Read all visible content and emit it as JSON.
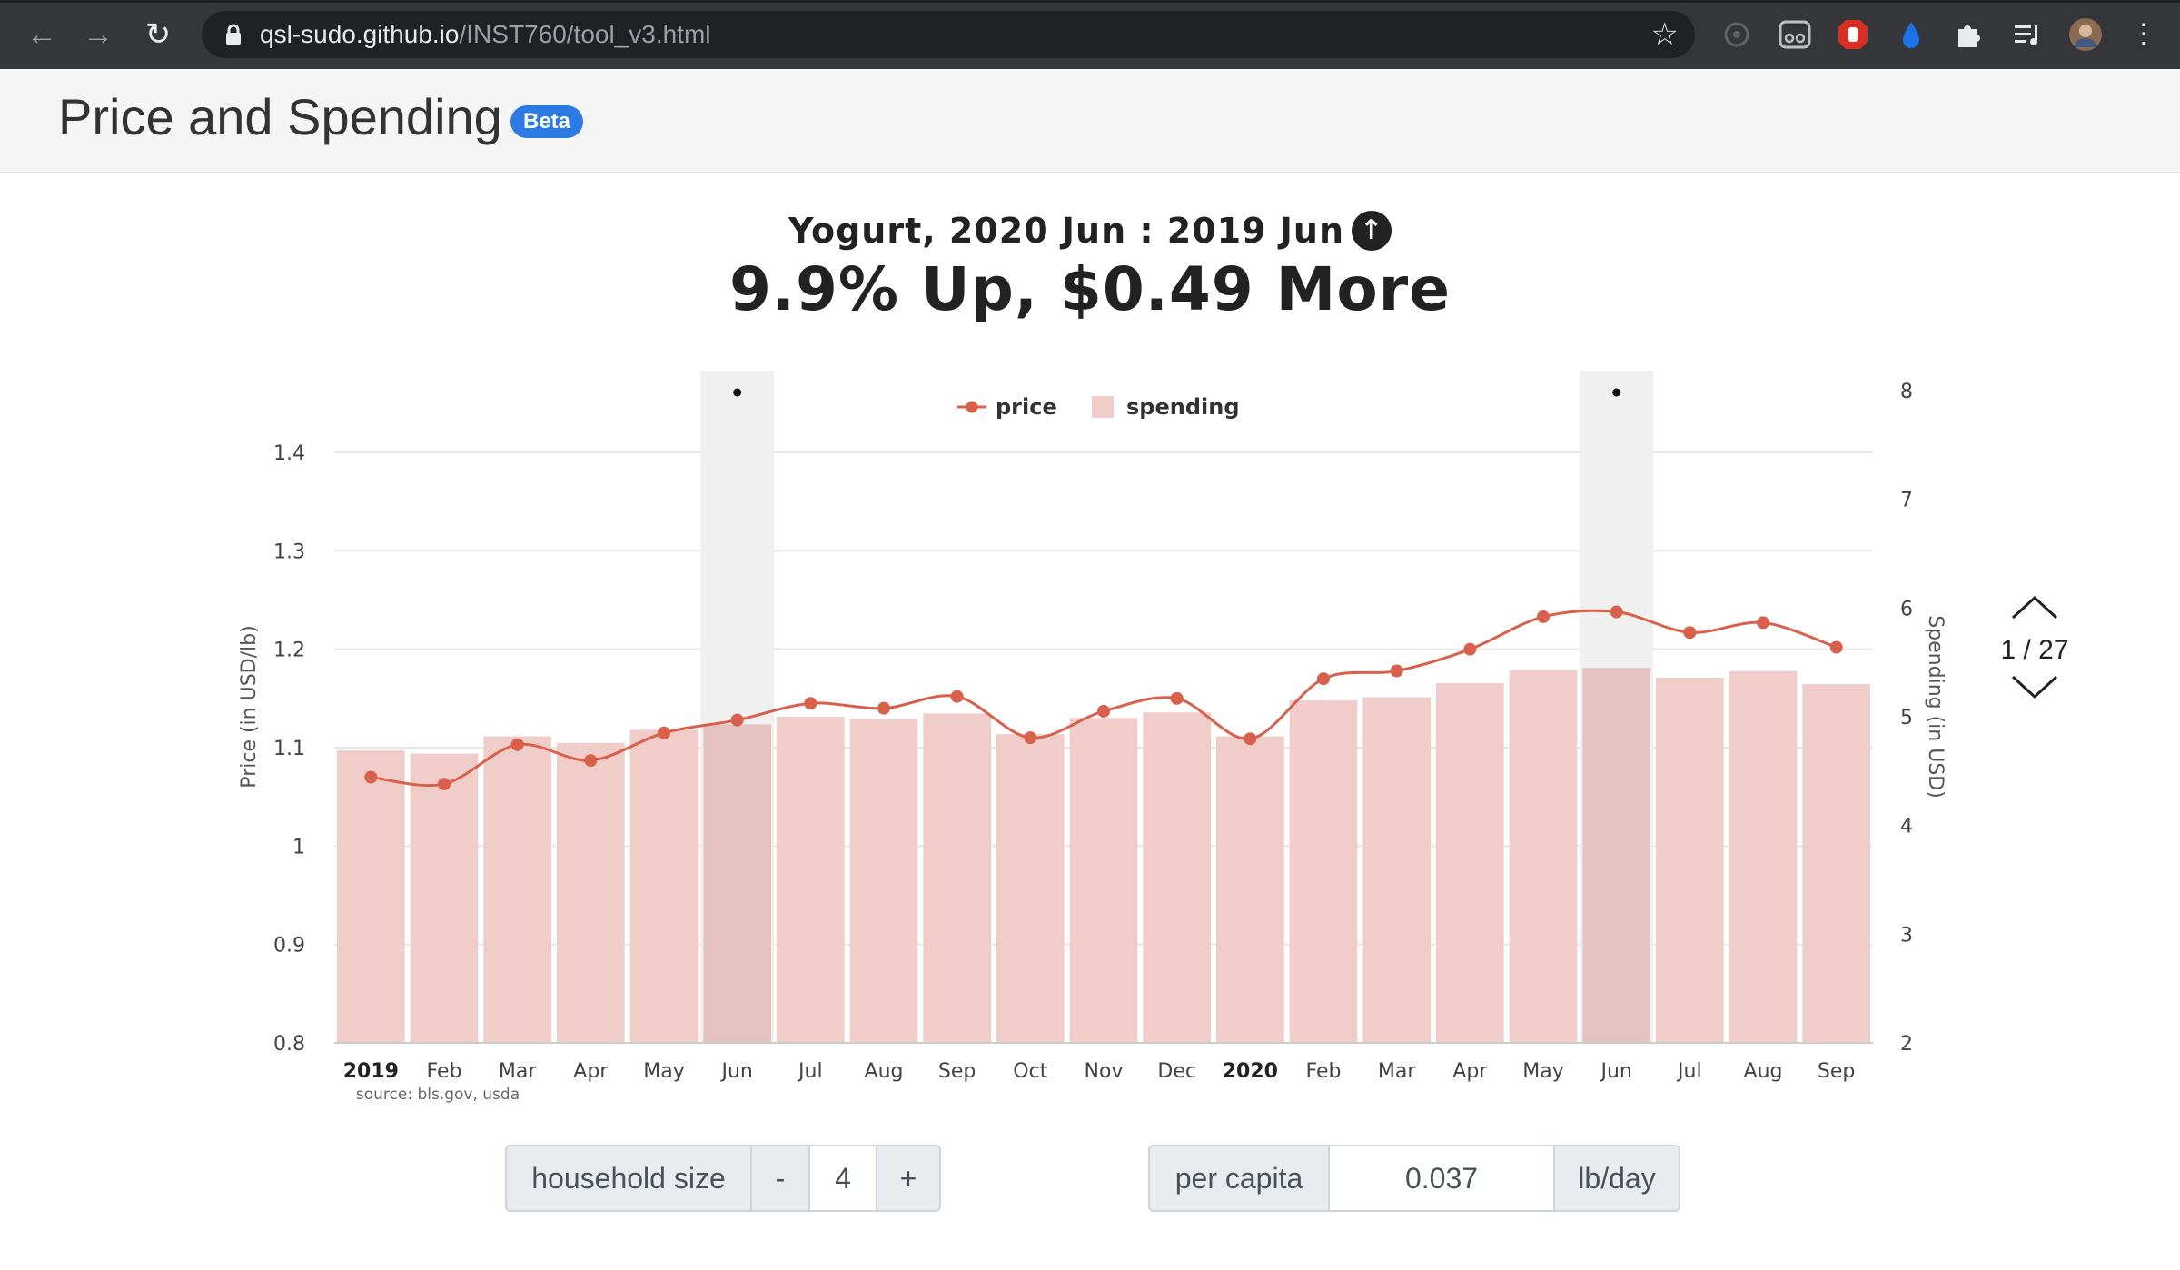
{
  "browser": {
    "url_host": "qsl-sudo.github.io",
    "url_path": "/INST760/tool_v3.html"
  },
  "app": {
    "title": "Price and Spending",
    "badge": "Beta"
  },
  "headline": {
    "subtitle": "Yogurt,  2020 Jun : 2019 Jun",
    "main": "9.9% Up, $0.49 More",
    "arrow_icon": "arrow-up-circle-icon"
  },
  "pager": {
    "count": "1 / 27"
  },
  "controls": {
    "household_label": "household size",
    "minus_label": "-",
    "household_value": "4",
    "plus_label": "+",
    "per_capita_label": "per capita",
    "per_capita_value": "0.037",
    "unit_label": "lb/day"
  },
  "chart_data": {
    "type": "bar+line",
    "categories": [
      "2019",
      "Feb",
      "Mar",
      "Apr",
      "May",
      "Jun",
      "Jul",
      "Aug",
      "Sep",
      "Oct",
      "Nov",
      "Dec",
      "2020",
      "Feb",
      "Mar",
      "Apr",
      "May",
      "Jun",
      "Jul",
      "Aug",
      "Sep"
    ],
    "bold_categories": [
      "2019",
      "2020"
    ],
    "series": [
      {
        "name": "price",
        "kind": "line",
        "axis": "left",
        "color": "#d9614c",
        "values": [
          1.07,
          1.063,
          1.103,
          1.087,
          1.115,
          1.128,
          1.145,
          1.14,
          1.152,
          1.11,
          1.137,
          1.15,
          1.109,
          1.17,
          1.178,
          1.2,
          1.233,
          1.238,
          1.217,
          1.227,
          1.202
        ]
      },
      {
        "name": "spending",
        "kind": "bar",
        "axis": "right",
        "color": "#f1cdca",
        "values": [
          4.69,
          4.66,
          4.82,
          4.76,
          4.88,
          4.93,
          5.0,
          4.98,
          5.03,
          4.84,
          4.99,
          5.04,
          4.82,
          5.15,
          5.18,
          5.31,
          5.43,
          5.45,
          5.36,
          5.42,
          5.3
        ]
      }
    ],
    "highlighted_indices": [
      5,
      17
    ],
    "ylabel": "Price (in USD/lb)",
    "ylim": [
      0.8,
      1.4
    ],
    "yticks": [
      0.8,
      0.9,
      1,
      1.1,
      1.2,
      1.3,
      1.4
    ],
    "y2label": "Spending (in USD)",
    "y2lim": [
      2,
      8
    ],
    "y2ticks": [
      2,
      3,
      4,
      5,
      6,
      7,
      8
    ],
    "legend_position": "top-center",
    "grid": true,
    "source": "source: bls.gov, usda"
  }
}
